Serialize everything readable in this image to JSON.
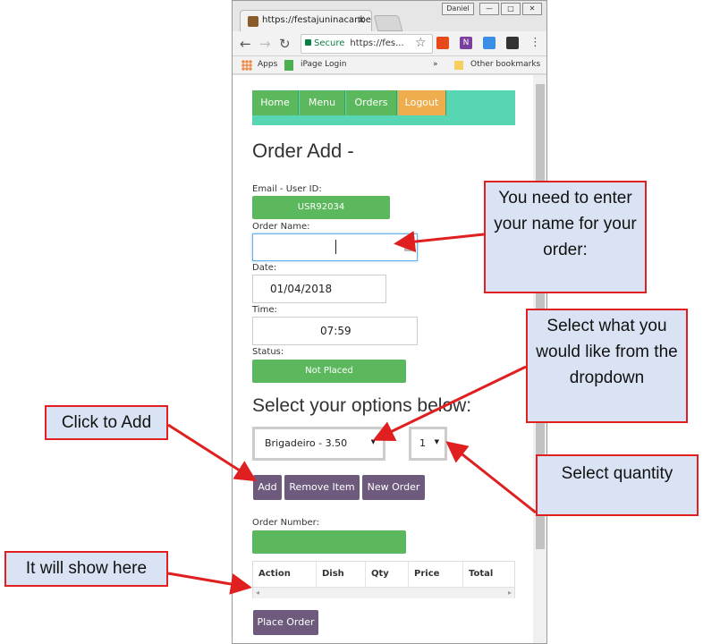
{
  "browser": {
    "tab_title": "https://festajuninacanbe",
    "tab_close": "×",
    "user_badge": "Daniel",
    "window_controls": {
      "minimize": "—",
      "maximize": "□",
      "close": "✕"
    },
    "omnibox": {
      "secure_label": "Secure",
      "url": "https://fes..."
    },
    "bookmarks": {
      "apps": "Apps",
      "ipage": "iPage Login",
      "overflow": "»",
      "other": "Other bookmarks"
    }
  },
  "nav": {
    "home": "Home",
    "menu": "Menu",
    "orders": "Orders",
    "logout": "Logout"
  },
  "page": {
    "title": "Order Add -",
    "email_label": "Email - User ID:",
    "user_id": "USR92034",
    "order_name_label": "Order Name:",
    "order_name_value": "",
    "date_label": "Date:",
    "date_value": "01/04/2018",
    "time_label": "Time:",
    "time_value": "07:59",
    "status_label": "Status:",
    "status_value": "Not Placed",
    "options_heading": "Select your options below:",
    "dish_select": "Brigadeiro - 3.50",
    "qty_select": "1",
    "add_button": "Add",
    "remove_button": "Remove Item",
    "new_order_button": "New Order",
    "order_number_label": "Order Number:",
    "order_number_value": "",
    "table_headers": [
      "Action",
      "Dish",
      "Qty",
      "Price",
      "Total"
    ],
    "place_order_button": "Place Order"
  },
  "callouts": {
    "enter_name": "You need to enter your name for your order:",
    "dropdown": "Select what you would like from the dropdown",
    "click_add": "Click to Add",
    "quantity": "Select quantity",
    "show_here": "It will show here"
  },
  "colors": {
    "nav_bar": "#57d6b4",
    "green": "#5cb85c",
    "orange": "#f0ad4e",
    "purple": "#6d5a7d",
    "callout_fill": "#dae3f3",
    "callout_border": "#e02020"
  }
}
